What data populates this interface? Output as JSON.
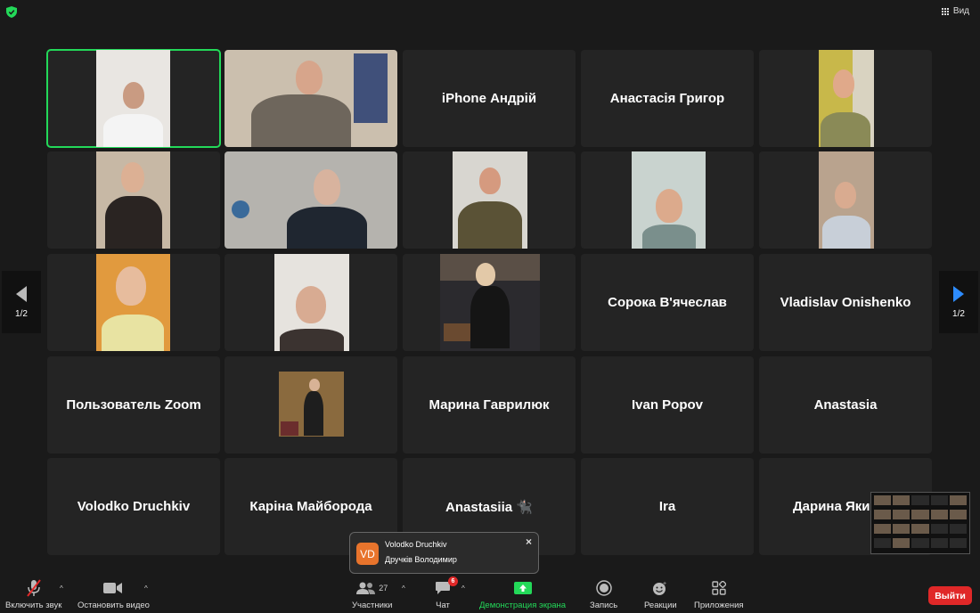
{
  "topbar": {
    "view_label": "Вид"
  },
  "pager": {
    "left_label": "1/2",
    "right_label": "1/2"
  },
  "tiles": [
    {
      "name": ""
    },
    {
      "name": ""
    },
    {
      "name": "iPhone Андрій"
    },
    {
      "name": "Анастасія Григор"
    },
    {
      "name": ""
    },
    {
      "name": ""
    },
    {
      "name": ""
    },
    {
      "name": ""
    },
    {
      "name": ""
    },
    {
      "name": ""
    },
    {
      "name": ""
    },
    {
      "name": ""
    },
    {
      "name": ""
    },
    {
      "name": "Сорока В'ячеслав"
    },
    {
      "name": "Vladislav Onishenko"
    },
    {
      "name": "Пользователь Zoom"
    },
    {
      "name": ""
    },
    {
      "name": "Марина Гаврилюк"
    },
    {
      "name": "Ivan Popov"
    },
    {
      "name": "Anastasia"
    },
    {
      "name": "Volodko Druchkiv"
    },
    {
      "name": "Каріна Майборода"
    },
    {
      "name": "Anastasiia 🐈‍⬛"
    },
    {
      "name": "Ira"
    },
    {
      "name": "Дарина Яки"
    }
  ],
  "toast": {
    "initials": "VD",
    "sender": "Volodko Druchkiv",
    "message": "Дручків Володимир",
    "close": "×"
  },
  "toolbar": {
    "unmute": "Включить звук",
    "stop_video": "Остановить видео",
    "participants": "Участники",
    "participants_count": "27",
    "chat": "Чат",
    "chat_badge": "6",
    "share_screen": "Демонстрация экрана",
    "record": "Запись",
    "reactions": "Реакции",
    "apps": "Приложения",
    "leave": "Выйти"
  },
  "colors": {
    "active_speaker": "#23d959",
    "share_green": "#23d959",
    "leave_red": "#e02828",
    "accent_blue": "#2d8cff"
  }
}
